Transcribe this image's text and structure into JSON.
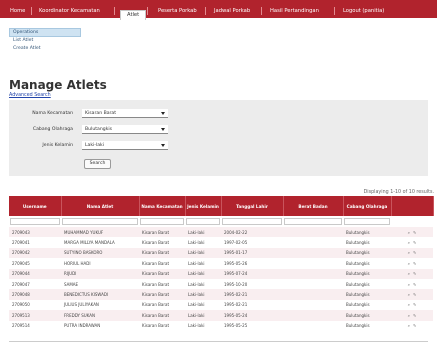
{
  "nav": {
    "tabs": [
      {
        "label": "Home"
      },
      {
        "label": "Koordinator Kecamatan"
      },
      {
        "label": "Atlet"
      },
      {
        "label": "Peserta Porkab"
      },
      {
        "label": "Jadwal Porkab"
      },
      {
        "label": "Hasil Pertandingan"
      },
      {
        "label": "Logout (panitia)"
      }
    ],
    "active_index": 2
  },
  "sidebar": {
    "heading": "Operations",
    "items": [
      {
        "label": "List Atlet"
      },
      {
        "label": "Create Atlet"
      }
    ]
  },
  "page": {
    "title": "Manage Atlets",
    "advanced_search": "Advanced Search"
  },
  "search": {
    "kecamatan_label": "Nama Kecamatan",
    "kecamatan_value": "Kisaran Barat",
    "olahraga_label": "Cabang Olahraga",
    "olahraga_value": "Bulutangkis",
    "kelamin_label": "Jenis Kelamin",
    "kelamin_value": "Laki-laki",
    "button": "Search"
  },
  "grid": {
    "summary": "Displaying 1-10 of 10 results.",
    "columns": [
      "Username",
      "Nama Atlet",
      "Nama Kecamatan",
      "Jenis Kelamin",
      "Tanggal Lahir",
      "Berat Badan",
      "Cabang Olahraga"
    ],
    "rows": [
      {
        "username": "2709043",
        "nama": "MUHAMMAD YUKUF",
        "kecamatan": "Kisaran Barat",
        "kelamin": "Laki-laki",
        "tanggal": "2004-02-22",
        "berat": "",
        "cabang": "Bulutangkis"
      },
      {
        "username": "2709041",
        "nama": "MARGA MILLYA MANDALA",
        "kecamatan": "Kisaran Barat",
        "kelamin": "Laki-laki",
        "tanggal": "1997-02-05",
        "berat": "",
        "cabang": "Bulutangkis"
      },
      {
        "username": "2709042",
        "nama": "SUTYINO BASKORO",
        "kecamatan": "Kisaran Barat",
        "kelamin": "Laki-laki",
        "tanggal": "1995-01-17",
        "berat": "",
        "cabang": "Bulutangkis"
      },
      {
        "username": "2709045",
        "nama": "HORIUL HADI",
        "kecamatan": "Kisaran Barat",
        "kelamin": "Laki-laki",
        "tanggal": "1995-05-26",
        "berat": "",
        "cabang": "Bulutangkis"
      },
      {
        "username": "2709044",
        "nama": "RIJUDI",
        "kecamatan": "Kisaran Barat",
        "kelamin": "Laki-laki",
        "tanggal": "1995-07-24",
        "berat": "",
        "cabang": "Bulutangkis"
      },
      {
        "username": "2709047",
        "nama": "SAMAE",
        "kecamatan": "Kisaran Barat",
        "kelamin": "Laki-laki",
        "tanggal": "1995-10-20",
        "berat": "",
        "cabang": "Bulutangkis"
      },
      {
        "username": "2709048",
        "nama": "BENEDICTUS KISWADI",
        "kecamatan": "Kisaran Barat",
        "kelamin": "Laki-laki",
        "tanggal": "1995-02-21",
        "berat": "",
        "cabang": "Bulutangkis"
      },
      {
        "username": "2709050",
        "nama": "JULIUS JULIYAKAN",
        "kecamatan": "Kisaran Barat",
        "kelamin": "Laki-laki",
        "tanggal": "1995-02-21",
        "berat": "",
        "cabang": "Bulutangkis"
      },
      {
        "username": "2709513",
        "nama": "FREDDY SUKAN",
        "kecamatan": "Kisaran Barat",
        "kelamin": "Laki-laki",
        "tanggal": "1995-05-24",
        "berat": "",
        "cabang": "Bulutangkis"
      },
      {
        "username": "2709514",
        "nama": "PUTRA INDRAWAN",
        "kecamatan": "Kisaran Barat",
        "kelamin": "Laki-laki",
        "tanggal": "1995-05-25",
        "berat": "",
        "cabang": "Bulutangkis"
      }
    ],
    "row_actions": {
      "view_icon": "magnifier-icon",
      "edit_icon": "pencil-icon"
    }
  },
  "colors": {
    "accent": "#b1232d",
    "search_bg": "#ececec",
    "row_alt": "#f9eef0"
  }
}
